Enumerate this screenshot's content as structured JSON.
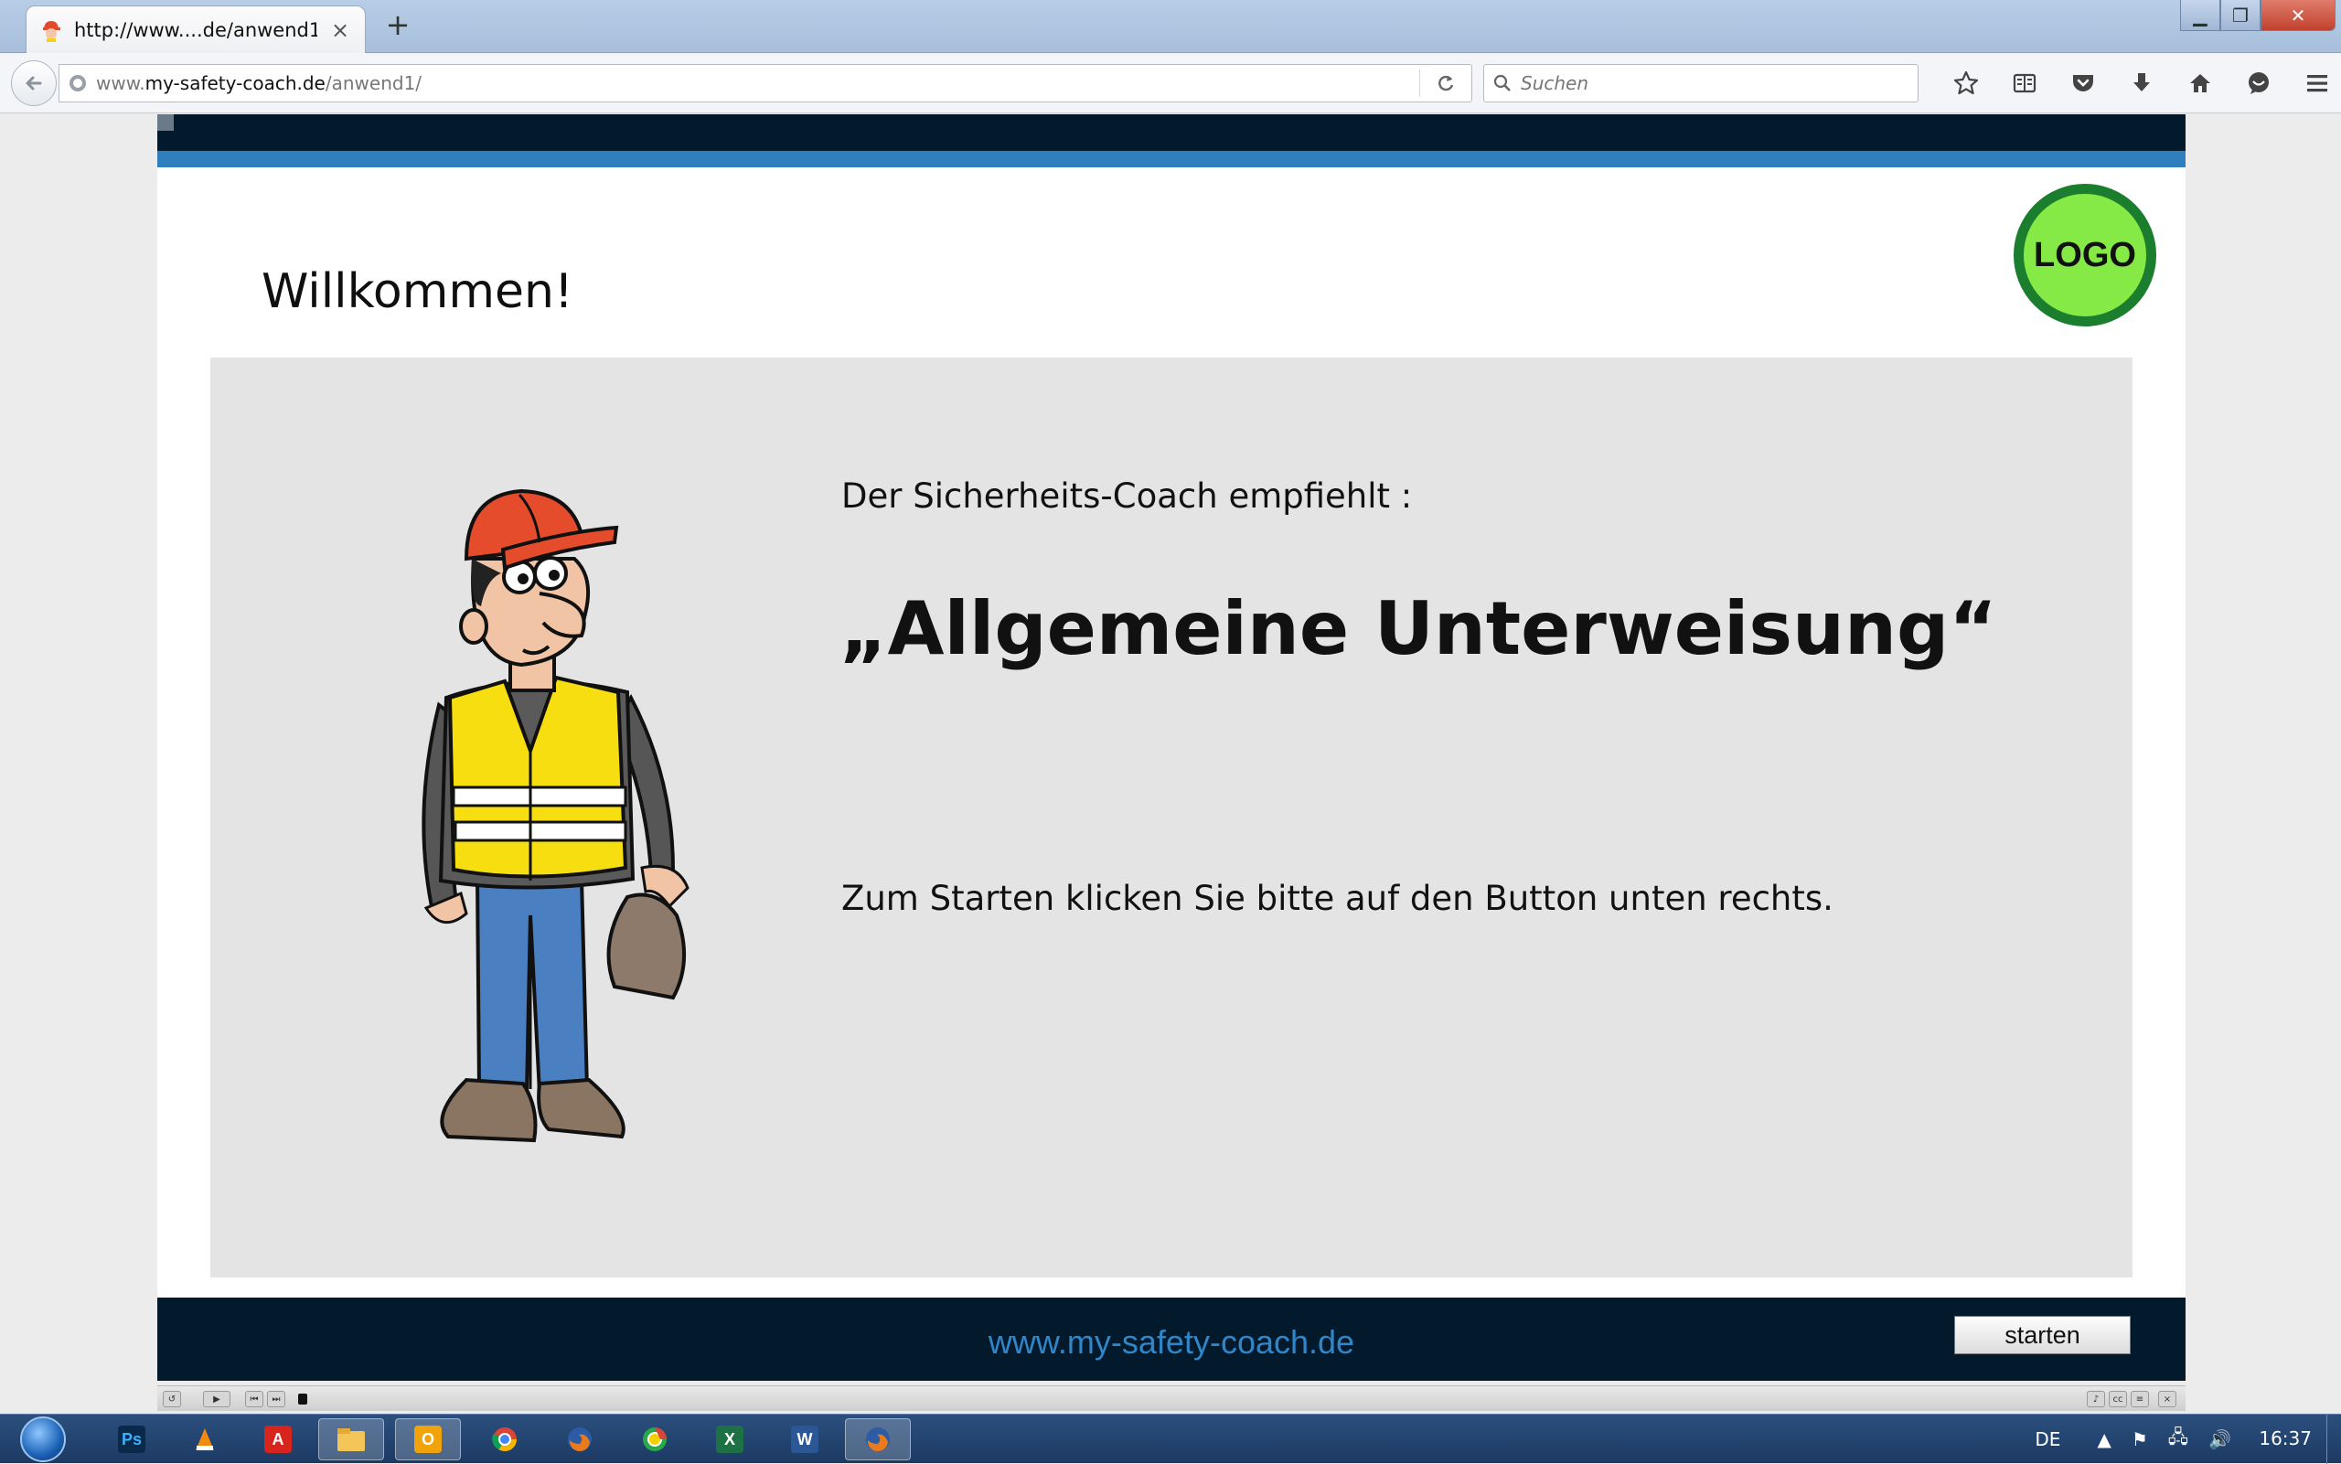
{
  "browser": {
    "tab_title": "http://www....de/anwend1/",
    "tab_close": "×",
    "new_tab": "+",
    "window_controls": {
      "minimize": "▁",
      "maximize": "❐",
      "close": "✕"
    },
    "url_domain_prefix": "www.",
    "url_domain": "my-safety-coach.de",
    "url_path": "/anwend1/",
    "search_placeholder": "Suchen",
    "toolbar_icons": [
      "star-icon",
      "reading-list-icon",
      "pocket-icon",
      "download-icon",
      "home-icon",
      "chat-icon",
      "menu-icon"
    ]
  },
  "page": {
    "welcome": "Willkommen!",
    "logo": "LOGO",
    "coach_text": "Der Sicherheits-Coach empfiehlt :",
    "course_title": "„Allgemeine Unterweisung“",
    "start_hint": "Zum Starten klicken Sie bitte auf den Button unten rechts.",
    "footer_url": "www.my-safety-coach.de",
    "start_button": "starten",
    "colors": {
      "band": "#03192c",
      "stripe": "#2f7fbf",
      "panel": "#e4e4e4",
      "logo_fill": "#86ea46",
      "logo_ring": "#1b7d2e",
      "footer_link": "#2f86c8"
    },
    "illustration": "construction-worker-icon"
  },
  "taskbar": {
    "apps": [
      "photoshop-icon",
      "vlc-icon",
      "acrobat-icon",
      "explorer-icon",
      "outlook-icon",
      "chrome-icon",
      "firefox-icon",
      "chrome-alt-icon",
      "excel-icon",
      "word-icon",
      "firefox-active-icon"
    ],
    "app_labels": {
      "photoshop": "Ps",
      "outlook": "O",
      "excel": "X",
      "word": "W"
    },
    "language": "DE",
    "clock": "16:37"
  }
}
